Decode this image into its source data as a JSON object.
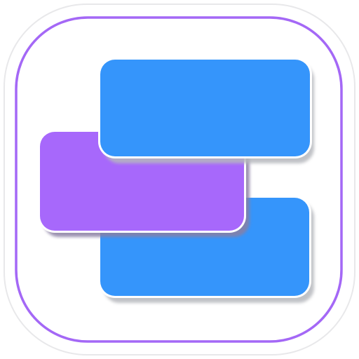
{
  "icon": {
    "name": "stacked-rectangles-app-icon",
    "colors": {
      "background": "#ffffff",
      "outer_border": "#e8e8ea",
      "inner_outline": "#a468f6",
      "blue_block": "#3595fb",
      "purple_block": "#a768fb",
      "block_edge": "#ffffff",
      "block_shadow": "#b6b8bd"
    }
  }
}
